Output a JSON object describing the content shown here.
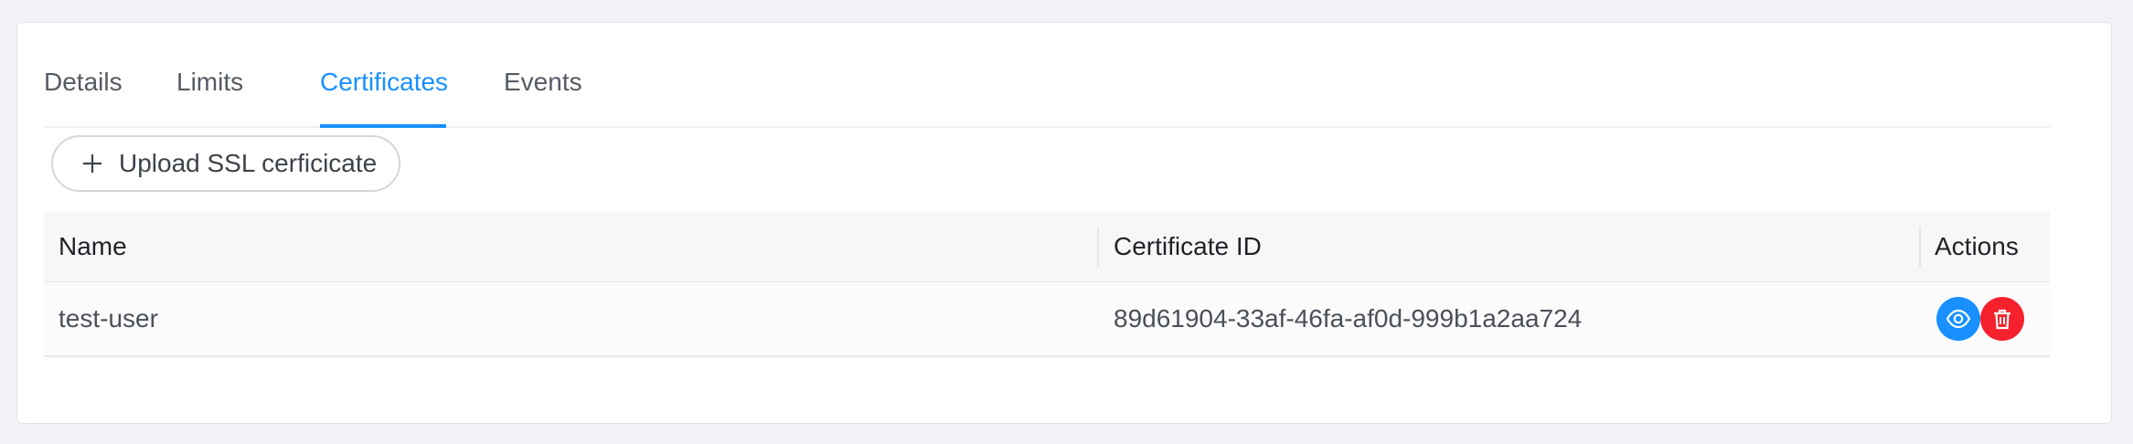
{
  "tabs": [
    {
      "label": "Details",
      "active": false
    },
    {
      "label": "Limits",
      "active": false
    },
    {
      "label": "Certificates",
      "active": true
    },
    {
      "label": "Events",
      "active": false
    }
  ],
  "toolbar": {
    "upload_label": "Upload SSL cerficicate",
    "upload_icon": "plus-icon"
  },
  "table": {
    "columns": [
      "Name",
      "Certificate ID",
      "Actions"
    ],
    "rows": [
      {
        "name": "test-user",
        "certificate_id": "89d61904-33af-46fa-af0d-999b1a2aa724",
        "actions": [
          "eye-icon",
          "trash-icon"
        ]
      }
    ]
  },
  "colors": {
    "accent": "#1890ff",
    "danger": "#f5222d",
    "page_background": "#f0f2f5"
  }
}
